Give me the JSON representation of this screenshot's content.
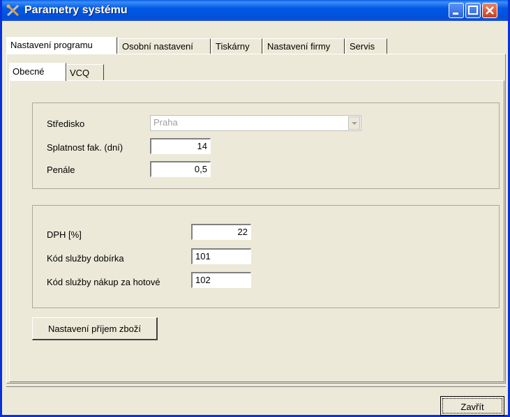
{
  "window": {
    "title": "Parametry systému"
  },
  "tabs": [
    {
      "label": "Nastavení programu"
    },
    {
      "label": "Osobní nastavení"
    },
    {
      "label": "Tiskárny"
    },
    {
      "label": "Nastavení firmy"
    },
    {
      "label": "Servis"
    }
  ],
  "subtabs": [
    {
      "label": "Obecné"
    },
    {
      "label": "VCQ"
    }
  ],
  "group1": {
    "stredisko_label": "Středisko",
    "stredisko_value": "Praha",
    "splatnost_label": "Splatnost fak. (dní)",
    "splatnost_value": "14",
    "penale_label": "Penále",
    "penale_value": "0,5"
  },
  "group2": {
    "dph_label": "DPH [%]",
    "dph_value": "22",
    "dobirka_label": "Kód služby dobírka",
    "dobirka_value": "101",
    "nakup_label": "Kód služby nákup za hotové",
    "nakup_value": "102"
  },
  "buttons": {
    "prijem_label": "Nastavení příjem zboží",
    "close_label": "Zavřít"
  }
}
